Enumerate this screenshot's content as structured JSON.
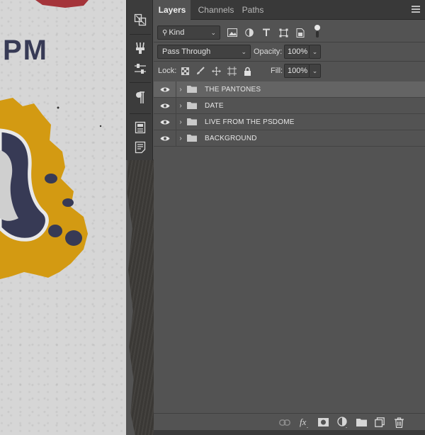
{
  "canvas": {
    "poster_text": "PM"
  },
  "tabs": [
    {
      "label": "Layers",
      "active": true
    },
    {
      "label": "Channels",
      "active": false
    },
    {
      "label": "Paths",
      "active": false
    }
  ],
  "filter": {
    "label": "Kind"
  },
  "blend": {
    "mode": "Pass Through",
    "opacity_label": "Opacity:",
    "opacity_value": "100%"
  },
  "lock": {
    "label": "Lock:",
    "fill_label": "Fill:",
    "fill_value": "100%"
  },
  "layers": [
    {
      "name": "THE PANTONES",
      "type": "group",
      "visible": true,
      "selected": true
    },
    {
      "name": "DATE",
      "type": "group",
      "visible": true,
      "selected": false
    },
    {
      "name": "LIVE FROM THE PSDOME",
      "type": "group",
      "visible": true,
      "selected": false
    },
    {
      "name": "BACKGROUND",
      "type": "group",
      "visible": true,
      "selected": false
    }
  ],
  "colors": {
    "panel_bg": "#535353",
    "selected_row": "#646464",
    "poster_ink": "#373a55",
    "poster_yellow": "#d39a12",
    "poster_red": "#a4343a"
  }
}
